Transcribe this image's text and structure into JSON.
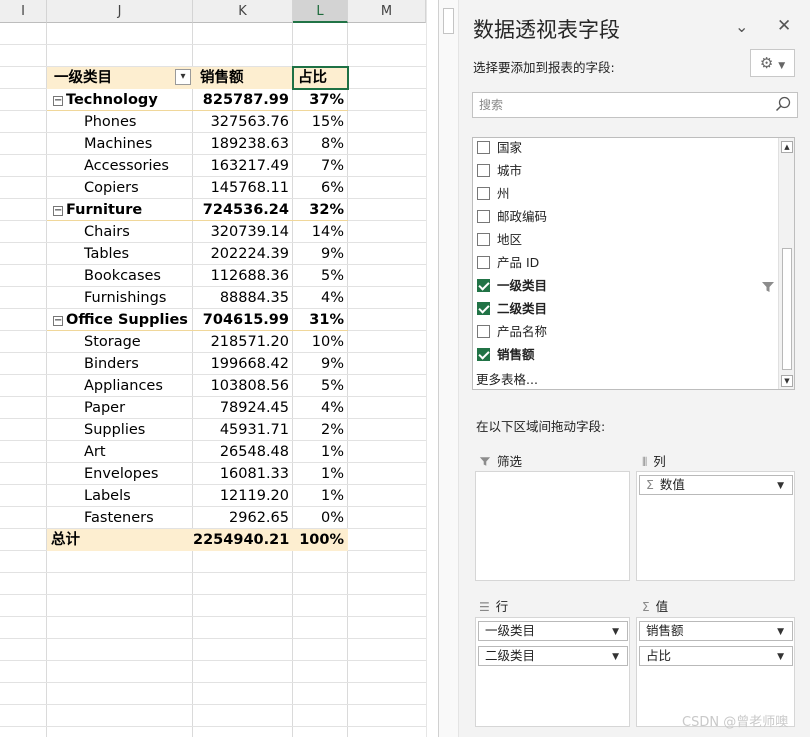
{
  "sheet": {
    "columns": [
      "I",
      "J",
      "K",
      "L",
      "M"
    ],
    "pivot_headers": {
      "category": "一级类目",
      "sales": "销售额",
      "share": "占比"
    },
    "rows": [
      {
        "level": 1,
        "label": "Technology",
        "value": "825787.99",
        "pct": "37%"
      },
      {
        "level": 2,
        "label": "Phones",
        "value": "327563.76",
        "pct": "15%"
      },
      {
        "level": 2,
        "label": "Machines",
        "value": "189238.63",
        "pct": "8%"
      },
      {
        "level": 2,
        "label": "Accessories",
        "value": "163217.49",
        "pct": "7%"
      },
      {
        "level": 2,
        "label": "Copiers",
        "value": "145768.11",
        "pct": "6%"
      },
      {
        "level": 1,
        "label": "Furniture",
        "value": "724536.24",
        "pct": "32%"
      },
      {
        "level": 2,
        "label": "Chairs",
        "value": "320739.14",
        "pct": "14%"
      },
      {
        "level": 2,
        "label": "Tables",
        "value": "202224.39",
        "pct": "9%"
      },
      {
        "level": 2,
        "label": "Bookcases",
        "value": "112688.36",
        "pct": "5%"
      },
      {
        "level": 2,
        "label": "Furnishings",
        "value": "88884.35",
        "pct": "4%"
      },
      {
        "level": 1,
        "label": "Office Supplies",
        "value": "704615.99",
        "pct": "31%"
      },
      {
        "level": 2,
        "label": "Storage",
        "value": "218571.20",
        "pct": "10%"
      },
      {
        "level": 2,
        "label": "Binders",
        "value": "199668.42",
        "pct": "9%"
      },
      {
        "level": 2,
        "label": "Appliances",
        "value": "103808.56",
        "pct": "5%"
      },
      {
        "level": 2,
        "label": "Paper",
        "value": "78924.45",
        "pct": "4%"
      },
      {
        "level": 2,
        "label": "Supplies",
        "value": "45931.71",
        "pct": "2%"
      },
      {
        "level": 2,
        "label": "Art",
        "value": "26548.48",
        "pct": "1%"
      },
      {
        "level": 2,
        "label": "Envelopes",
        "value": "16081.33",
        "pct": "1%"
      },
      {
        "level": 2,
        "label": "Labels",
        "value": "12119.20",
        "pct": "1%"
      },
      {
        "level": 2,
        "label": "Fasteners",
        "value": "2962.65",
        "pct": "0%"
      }
    ],
    "total": {
      "label": "总计",
      "value": "2254940.21",
      "pct": "100%"
    },
    "collapse_glyph": "⊟"
  },
  "pane": {
    "title": "数据透视表字段",
    "subtitle": "选择要添加到报表的字段:",
    "search_placeholder": "搜索",
    "fields": [
      {
        "label": "国家",
        "checked": false
      },
      {
        "label": "城市",
        "checked": false
      },
      {
        "label": "州",
        "checked": false
      },
      {
        "label": "邮政编码",
        "checked": false
      },
      {
        "label": "地区",
        "checked": false
      },
      {
        "label": "产品 ID",
        "checked": false
      },
      {
        "label": "一级类目",
        "checked": true,
        "filtered": true
      },
      {
        "label": "二级类目",
        "checked": true
      },
      {
        "label": "产品名称",
        "checked": false
      },
      {
        "label": "销售额",
        "checked": true
      }
    ],
    "more_tables": "更多表格...",
    "drag_hint": "在以下区域间拖动字段:",
    "areas": {
      "filter": {
        "label": "筛选",
        "items": []
      },
      "columns": {
        "label": "列",
        "items": [
          "数值"
        ]
      },
      "rows": {
        "label": "行",
        "items": [
          "一级类目",
          "二级类目"
        ]
      },
      "values": {
        "label": "值",
        "items": [
          "销售额",
          "占比"
        ]
      }
    },
    "watermark": "CSDN @曾老师噢"
  }
}
